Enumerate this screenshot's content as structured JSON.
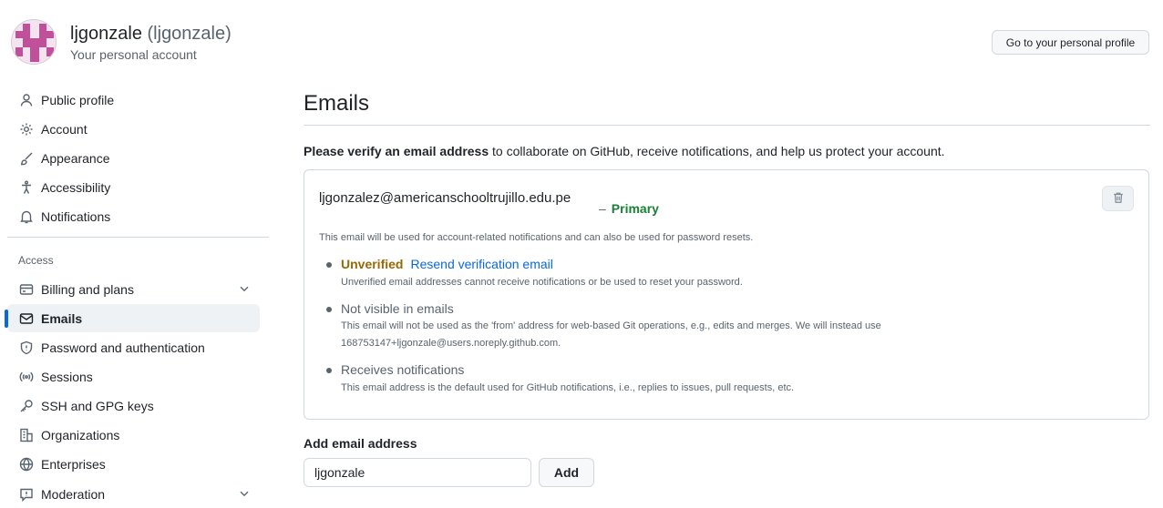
{
  "header": {
    "user_name": "ljgonzale",
    "user_login": "(ljgonzale)",
    "subtitle": "Your personal account",
    "profile_button": "Go to your personal profile"
  },
  "sidebar": {
    "items": [
      {
        "label": "Public profile",
        "icon": "person-icon"
      },
      {
        "label": "Account",
        "icon": "gear-icon"
      },
      {
        "label": "Appearance",
        "icon": "paintbrush-icon"
      },
      {
        "label": "Accessibility",
        "icon": "accessibility-icon"
      },
      {
        "label": "Notifications",
        "icon": "bell-icon"
      }
    ],
    "access_heading": "Access",
    "access_items": [
      {
        "label": "Billing and plans",
        "icon": "credit-card-icon",
        "expandable": true
      },
      {
        "label": "Emails",
        "icon": "mail-icon",
        "active": true
      },
      {
        "label": "Password and authentication",
        "icon": "shield-icon"
      },
      {
        "label": "Sessions",
        "icon": "broadcast-icon"
      },
      {
        "label": "SSH and GPG keys",
        "icon": "key-icon"
      },
      {
        "label": "Organizations",
        "icon": "organization-icon"
      },
      {
        "label": "Enterprises",
        "icon": "globe-icon"
      },
      {
        "label": "Moderation",
        "icon": "report-icon",
        "expandable": true
      }
    ]
  },
  "main": {
    "title": "Emails",
    "notice_bold": "Please verify an email address",
    "notice_rest": " to collaborate on GitHub, receive notifications, and help us protect your account.",
    "email": {
      "address": "ljgonzalez@americanschooltrujillo.edu.pe",
      "primary_dash": "–",
      "primary_label": "Primary",
      "description": "This email will be used for account-related notifications and can also be used for password resets.",
      "unverified_label": "Unverified",
      "resend_link": "Resend verification email",
      "unverified_desc": "Unverified email addresses cannot receive notifications or be used to reset your password.",
      "not_visible_title": "Not visible in emails",
      "not_visible_desc": "This email will not be used as the 'from' address for web-based Git operations, e.g., edits and merges. We will instead use 168753147+ljgonzale@users.noreply.github.com.",
      "receives_title": "Receives notifications",
      "receives_desc": "This email address is the default used for GitHub notifications, i.e., replies to issues, pull requests, etc."
    },
    "add_email": {
      "label": "Add email address",
      "input_value": "ljgonzale",
      "button": "Add"
    }
  },
  "colors": {
    "accent": "#0969da",
    "primary_green": "#1a7f37",
    "unverified": "#9a6700",
    "avatar_pink": "#c0509a"
  }
}
